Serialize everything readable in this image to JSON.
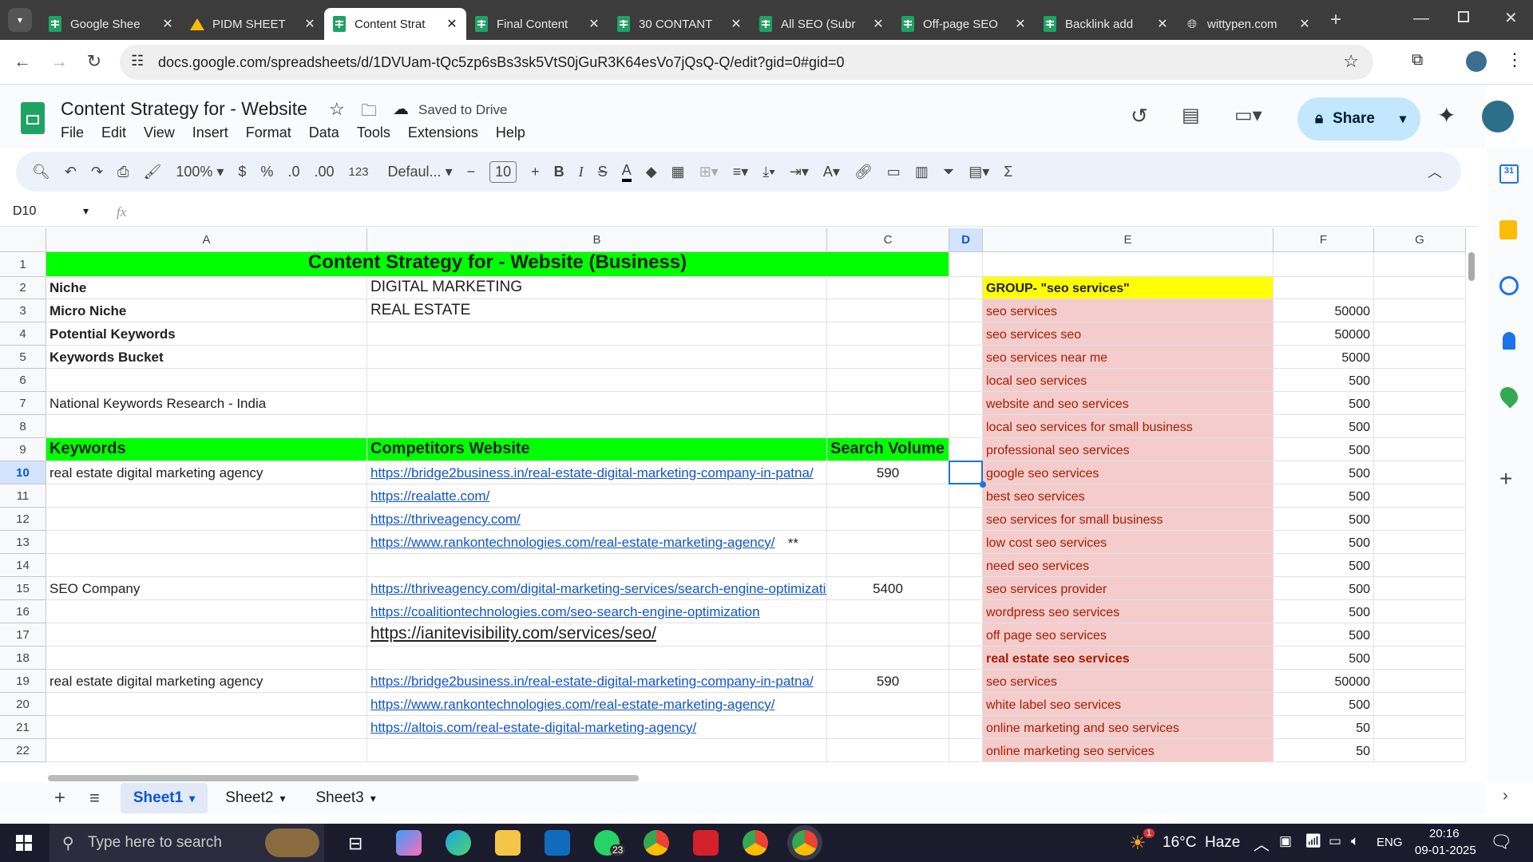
{
  "browser": {
    "tabs": [
      {
        "title": "Google Shee",
        "icon": "sheets-icon"
      },
      {
        "title": "PIDM SHEET",
        "icon": "drive-icon"
      },
      {
        "title": "Content Strat",
        "icon": "sheets-icon",
        "active": true
      },
      {
        "title": "Final Content",
        "icon": "sheets-icon"
      },
      {
        "title": "30 CONTANT",
        "icon": "sheets-icon"
      },
      {
        "title": "All SEO (Subr",
        "icon": "sheets-icon"
      },
      {
        "title": "Off-page SEO",
        "icon": "sheets-icon"
      },
      {
        "title": "Backlink add",
        "icon": "sheets-icon"
      },
      {
        "title": "wittypen.com",
        "icon": "globe-icon"
      }
    ],
    "url": "docs.google.com/spreadsheets/d/1DVUam-tQc5zp6sBs3sk5VtS0jGuR3K64esVo7jQsQ-Q/edit?gid=0#gid=0"
  },
  "doc": {
    "title": "Content Strategy for - Website",
    "saved": "Saved to Drive",
    "menus": [
      "File",
      "Edit",
      "View",
      "Insert",
      "Format",
      "Data",
      "Tools",
      "Extensions",
      "Help"
    ],
    "share": "Share"
  },
  "toolbar": {
    "zoom": "100%",
    "currency": "$",
    "percent": "%",
    "dec_decrease": ".0",
    "dec_increase": ".00",
    "format123": "123",
    "font": "Defaul...",
    "font_size": "10"
  },
  "formula_bar": {
    "cell_ref": "D10",
    "fx": "fx"
  },
  "columns": [
    "A",
    "B",
    "C",
    "D",
    "E",
    "F",
    "G"
  ],
  "rows": [
    "1",
    "2",
    "3",
    "4",
    "5",
    "6",
    "7",
    "8",
    "9",
    "10",
    "11",
    "12",
    "13",
    "14",
    "15",
    "16",
    "17",
    "18",
    "19",
    "20",
    "21",
    "22"
  ],
  "cells": {
    "title": "Content Strategy for - Website (Business)",
    "a2": "Niche",
    "b2": "DIGITAL MARKETING",
    "a3": "Micro Niche",
    "b3": "REAL ESTATE",
    "a4": "Potential Keywords",
    "a5": "Keywords Bucket",
    "a7": "National Keywords Research  - India",
    "a9": "Keywords",
    "b9": "Competitors Website",
    "c9": "Search Volume",
    "a10": "real estate digital marketing agency",
    "b10": "https://bridge2business.in/real-estate-digital-marketing-company-in-patna/",
    "c10": "590",
    "b11": "https://realatte.com/",
    "b12": "https://thriveagency.com/",
    "b13": "https://www.rankontechnologies.com/real-estate-marketing-agency/",
    "c13": "**",
    "a15": "SEO Company",
    "b15": "https://thriveagency.com/digital-marketing-services/search-engine-optimizatio",
    "c15": "5400",
    "b16": "https://coalitiontechnologies.com/seo-search-engine-optimization",
    "b17": "https://ianitevisibility.com/services/seo/",
    "a19": "real estate digital marketing agency",
    "b19": "https://bridge2business.in/real-estate-digital-marketing-company-in-patna/",
    "c19": "590",
    "b20": "https://www.rankontechnologies.com/real-estate-marketing-agency/",
    "b21": "https://altois.com/real-estate-digital-marketing-agency/",
    "e2": "GROUP- \"seo services\""
  },
  "group_keywords": [
    {
      "kw": "seo services",
      "vol": "50000"
    },
    {
      "kw": "seo services seo",
      "vol": "50000"
    },
    {
      "kw": "seo services near me",
      "vol": "5000"
    },
    {
      "kw": "local seo services",
      "vol": "500"
    },
    {
      "kw": "website and seo services",
      "vol": "500"
    },
    {
      "kw": "local seo services for small business",
      "vol": "500"
    },
    {
      "kw": "professional seo services",
      "vol": "500"
    },
    {
      "kw": "google seo services",
      "vol": "500"
    },
    {
      "kw": "best seo services",
      "vol": "500"
    },
    {
      "kw": "seo services for small business",
      "vol": "500"
    },
    {
      "kw": "low cost seo services",
      "vol": "500"
    },
    {
      "kw": "need seo services",
      "vol": "500"
    },
    {
      "kw": "seo services provider",
      "vol": "500"
    },
    {
      "kw": "wordpress seo services",
      "vol": "500"
    },
    {
      "kw": "off page seo services",
      "vol": "500"
    },
    {
      "kw": "real estate seo services",
      "vol": "500",
      "bold": true
    },
    {
      "kw": "seo services",
      "vol": "50000"
    },
    {
      "kw": "white label seo services",
      "vol": "500"
    },
    {
      "kw": "online marketing and seo services",
      "vol": "50"
    },
    {
      "kw": "online marketing seo services",
      "vol": "50"
    }
  ],
  "sheet_tabs": [
    "Sheet1",
    "Sheet2",
    "Sheet3"
  ],
  "taskbar": {
    "search_placeholder": "Type here to search",
    "weather": "16°C  Haze",
    "lang": "ENG",
    "time": "20:16",
    "date": "09-01-2025",
    "whatsapp_badge": "23",
    "weather_badge": "1"
  }
}
